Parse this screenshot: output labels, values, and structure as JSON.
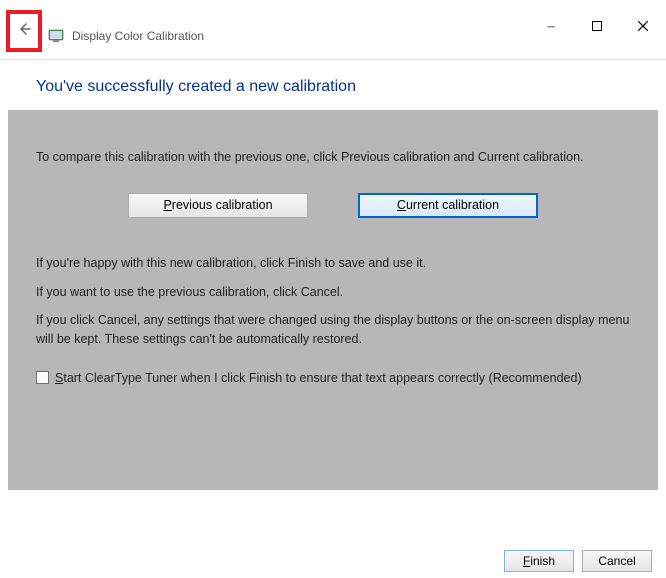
{
  "window": {
    "minimize": "—",
    "maximize": "☐",
    "close": "✕"
  },
  "header": {
    "back": "←",
    "title": "Display Color Calibration"
  },
  "heading": "You've successfully created a new calibration",
  "content": {
    "intro": "To compare this calibration with the previous one, click Previous calibration and Current calibration.",
    "buttons": {
      "previous": "Previous calibration",
      "current": "Current calibration"
    },
    "para_happy": "If you're happy with this new calibration, click Finish to save and use it.",
    "para_cancel": "If you want to use the previous calibration, click Cancel.",
    "para_warning": "If you click Cancel, any settings that were changed using the display buttons or the on-screen display menu will be kept. These settings can't be automatically restored.",
    "checkbox_label": "Start ClearType Tuner when I click Finish to ensure that text appears correctly (Recommended)"
  },
  "footer": {
    "finish": "Finish",
    "cancel": "Cancel"
  }
}
